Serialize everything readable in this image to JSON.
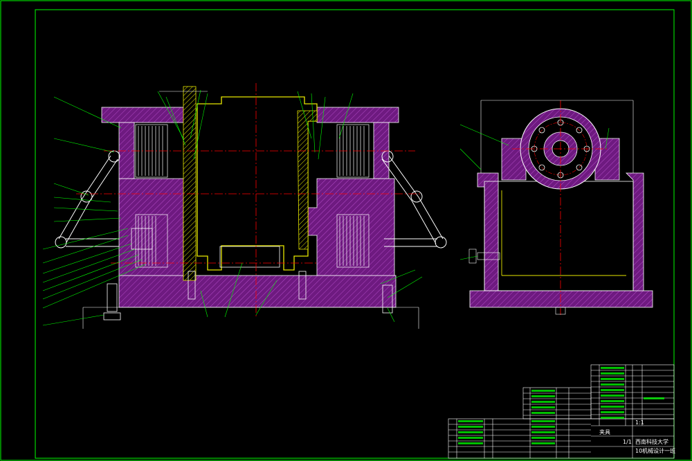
{
  "title_block": {
    "drawing_name": "夹具",
    "school": "西南科技大学",
    "class_label": "10机械设计一班",
    "scale": "1:1",
    "sheet": "1/1"
  },
  "colors": {
    "background": "#000000",
    "border": "#00ff00",
    "section_fill": "#7a1f8a",
    "centerline": "#ff0000",
    "yellow_part": "#e8e800",
    "leader": "#00ff00",
    "outline": "#ffffff"
  }
}
